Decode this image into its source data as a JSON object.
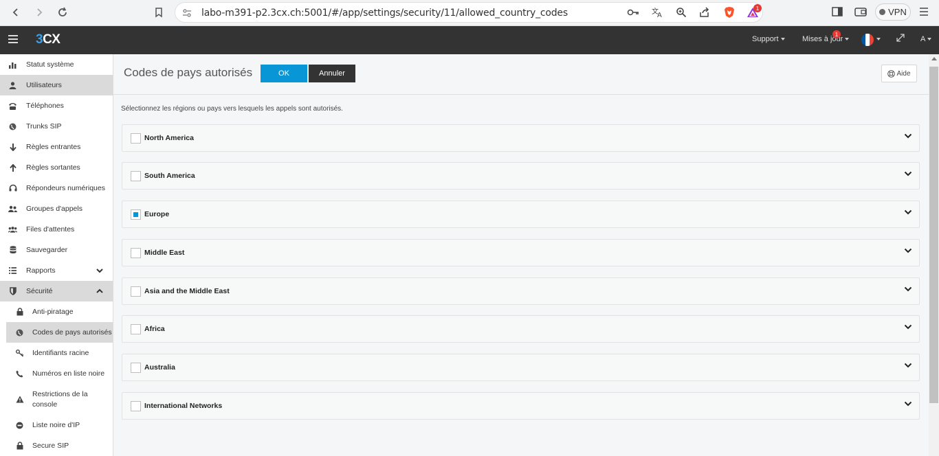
{
  "browser": {
    "url": "labo-m391-p2.3cx.ch:5001/#/app/settings/security/11/allowed_country_codes",
    "vpn_label": "VPN",
    "ext_badge": "1"
  },
  "header": {
    "logo_part1": "3",
    "logo_part2": "CX",
    "support_label": "Support",
    "updates_label": "Mises à jour",
    "updates_badge": "1",
    "user_label": "A"
  },
  "sidebar": {
    "items": [
      {
        "label": "Statut système",
        "icon": "bar-chart-icon"
      },
      {
        "label": "Utilisateurs",
        "icon": "user-icon"
      },
      {
        "label": "Téléphones",
        "icon": "phone-icon"
      },
      {
        "label": "Trunks SIP",
        "icon": "globe-icon"
      },
      {
        "label": "Règles entrantes",
        "icon": "arrow-down-icon"
      },
      {
        "label": "Règles sortantes",
        "icon": "arrow-up-icon"
      },
      {
        "label": "Répondeurs numériques",
        "icon": "headset-icon"
      },
      {
        "label": "Groupes d'appels",
        "icon": "group-icon"
      },
      {
        "label": "Files d'attentes",
        "icon": "queue-icon"
      },
      {
        "label": "Sauvegarder",
        "icon": "database-icon"
      },
      {
        "label": "Rapports",
        "icon": "list-icon"
      },
      {
        "label": "Sécurité",
        "icon": "shield-icon"
      }
    ],
    "security_sub": [
      {
        "label": "Anti-piratage",
        "icon": "lock-icon"
      },
      {
        "label": "Codes de pays autorisés",
        "icon": "globe-icon"
      },
      {
        "label": "Identifiants racine",
        "icon": "key-icon"
      },
      {
        "label": "Numéros en liste noire",
        "icon": "phone-icon"
      },
      {
        "label": "Restrictions de la console",
        "icon": "warning-icon"
      },
      {
        "label": "Liste noire d'IP",
        "icon": "minus-circle-icon"
      },
      {
        "label": "Secure SIP",
        "icon": "lock-icon"
      }
    ]
  },
  "page": {
    "title": "Codes de pays autorisés",
    "ok_label": "OK",
    "cancel_label": "Annuler",
    "help_label": "Aide",
    "intro": "Sélectionnez les régions ou pays vers lesquels les appels sont autorisés."
  },
  "regions": [
    {
      "label": "North America",
      "checked": false
    },
    {
      "label": "South America",
      "checked": false
    },
    {
      "label": "Europe",
      "checked": "partial"
    },
    {
      "label": "Middle East",
      "checked": false
    },
    {
      "label": "Asia and the Middle East",
      "checked": false
    },
    {
      "label": "Africa",
      "checked": false
    },
    {
      "label": "Australia",
      "checked": false
    },
    {
      "label": "International Networks",
      "checked": false
    }
  ],
  "colors": {
    "accent": "#0896d7",
    "header_bg": "#333333"
  }
}
